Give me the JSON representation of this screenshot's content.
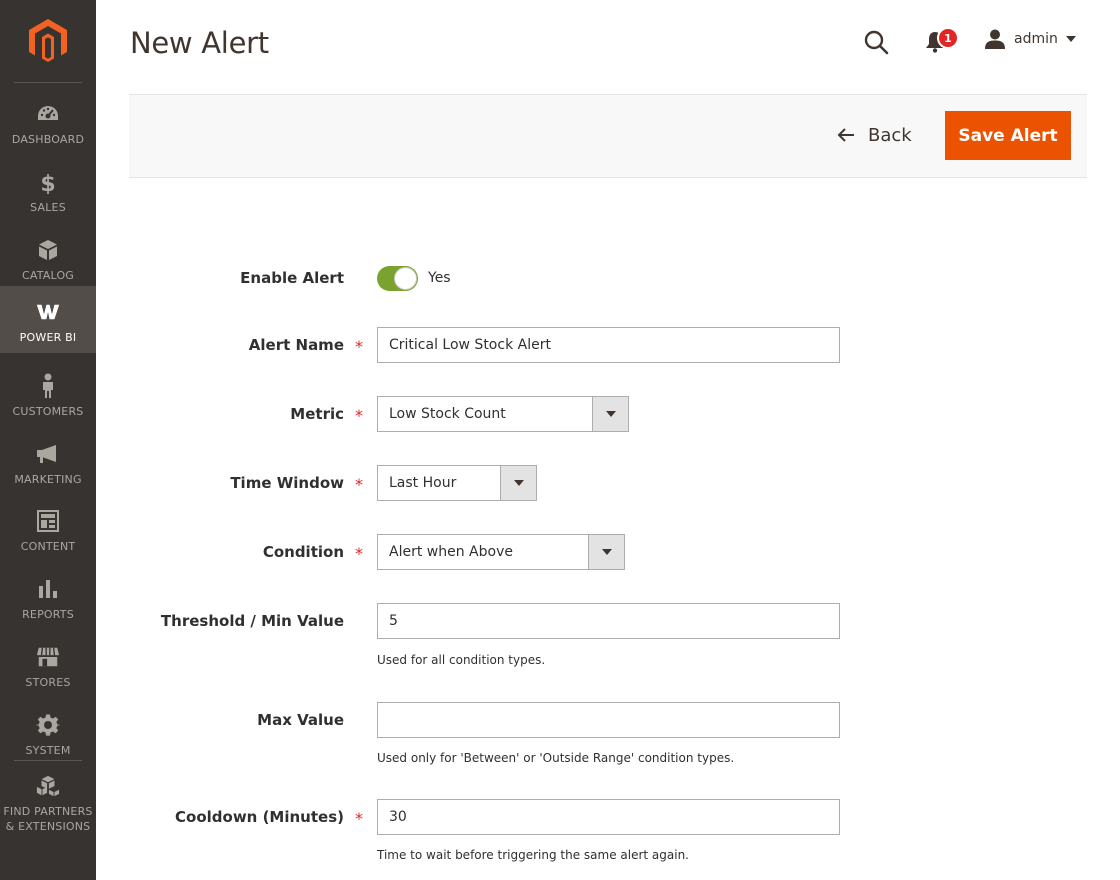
{
  "sidebar": {
    "logo": "magento-logo",
    "items": [
      {
        "label": "DASHBOARD",
        "icon": "dashboard-icon"
      },
      {
        "label": "SALES",
        "icon": "dollar-icon"
      },
      {
        "label": "CATALOG",
        "icon": "box-icon"
      },
      {
        "label": "POWER BI",
        "icon": "power-bi-icon",
        "active": true
      },
      {
        "label": "CUSTOMERS",
        "icon": "person-icon"
      },
      {
        "label": "MARKETING",
        "icon": "megaphone-icon"
      },
      {
        "label": "CONTENT",
        "icon": "layout-icon"
      },
      {
        "label": "REPORTS",
        "icon": "bar-chart-icon"
      },
      {
        "label": "STORES",
        "icon": "store-icon"
      },
      {
        "label": "SYSTEM",
        "icon": "gear-icon"
      },
      {
        "label": "FIND PARTNERS & EXTENSIONS",
        "icon": "cubes-icon"
      }
    ]
  },
  "header": {
    "title": "New Alert",
    "notification_count": "1",
    "user": "admin"
  },
  "actions": {
    "back_label": "Back",
    "save_label": "Save Alert"
  },
  "form": {
    "enable": {
      "label": "Enable Alert",
      "value": "Yes",
      "on": true
    },
    "name": {
      "label": "Alert Name",
      "value": "Critical Low Stock Alert",
      "required": true
    },
    "metric": {
      "label": "Metric",
      "value": "Low Stock Count",
      "required": true
    },
    "time_window": {
      "label": "Time Window",
      "value": "Last Hour",
      "required": true
    },
    "condition": {
      "label": "Condition",
      "value": "Alert when Above",
      "required": true
    },
    "threshold": {
      "label": "Threshold / Min Value",
      "value": "5",
      "note": "Used for all condition types."
    },
    "max_value": {
      "label": "Max Value",
      "value": "",
      "note": "Used only for 'Between' or 'Outside Range' condition types."
    },
    "cooldown": {
      "label": "Cooldown (Minutes)",
      "value": "30",
      "required": true,
      "note": "Time to wait before triggering the same alert again."
    }
  },
  "colors": {
    "sidebar_bg": "#373330",
    "accent": "#eb5202",
    "toggle_on": "#79a22e",
    "required": "#e22626"
  }
}
